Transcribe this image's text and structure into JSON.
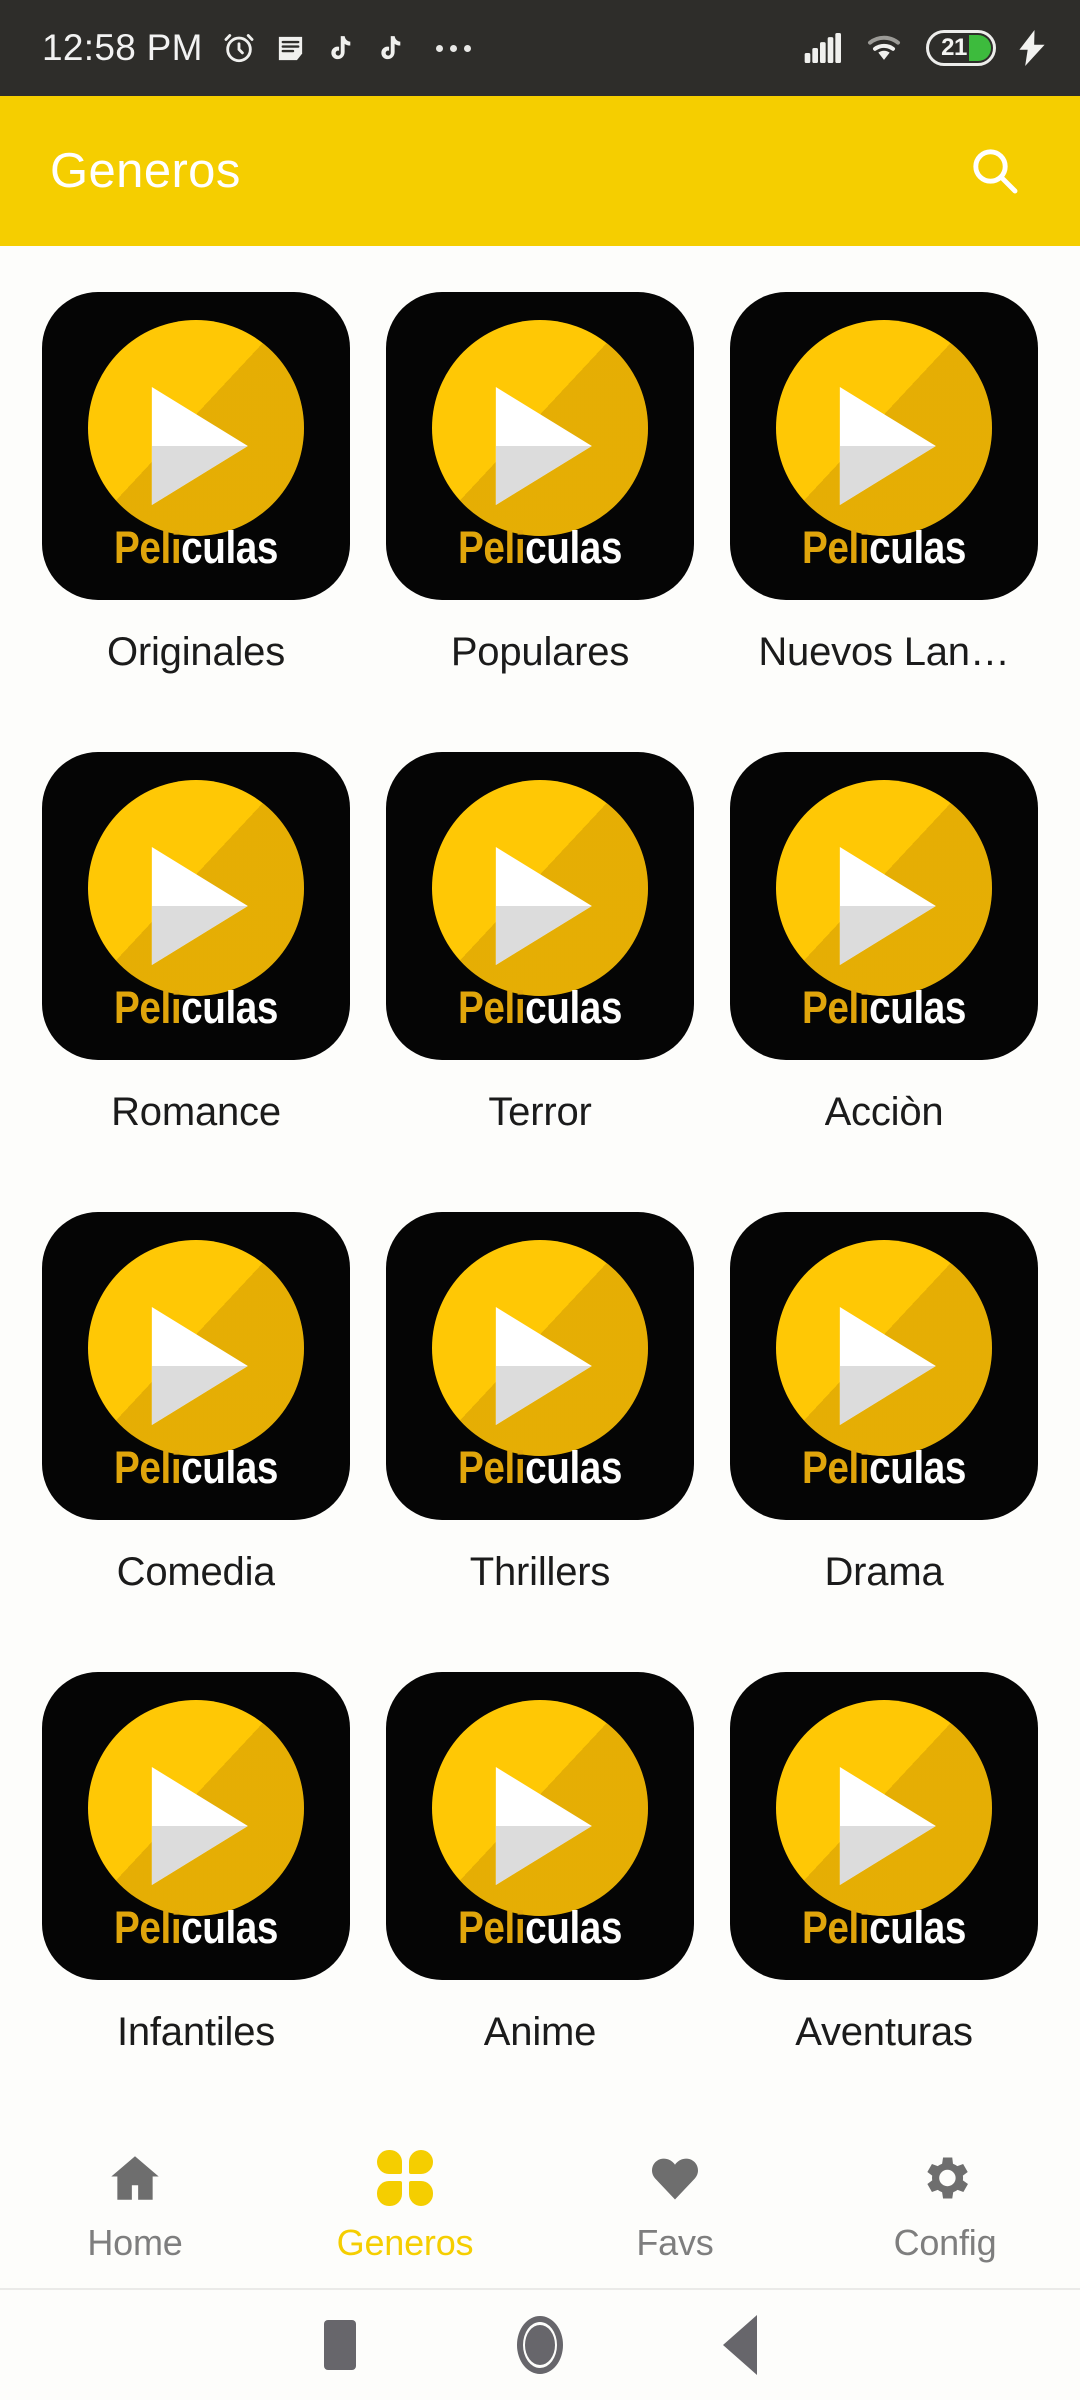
{
  "status_bar": {
    "time": "12:58 PM",
    "left_icons": [
      "alarm-clock-icon",
      "notes-icon",
      "tiktok-icon",
      "tiktok-icon",
      "more-dots-icon"
    ],
    "battery_percent": "21",
    "right_icons": [
      "signal-icon",
      "wifi-icon",
      "battery-icon",
      "charging-bolt-icon"
    ],
    "bg_color": "#2E2D2A"
  },
  "app_bar": {
    "title": "Generos",
    "search_icon": "search-icon",
    "bg_color": "#F5CE00",
    "title_color": "#FFFFFF"
  },
  "tile": {
    "brand_prefix": "Peli",
    "brand_suffix": "culas",
    "brand_prefix_color": "#E0A50B",
    "brand_suffix_color": "#FFFFFF",
    "bg_color": "#050505",
    "circle_color": "#FFC805",
    "play_icon": "play-triangle-icon"
  },
  "grid": {
    "items": [
      {
        "label": "Originales"
      },
      {
        "label": "Populares"
      },
      {
        "label": "Nuevos Lan…"
      },
      {
        "label": "Romance"
      },
      {
        "label": "Terror"
      },
      {
        "label": "Acciòn"
      },
      {
        "label": "Comedia"
      },
      {
        "label": "Thrillers"
      },
      {
        "label": "Drama"
      },
      {
        "label": "Infantiles"
      },
      {
        "label": "Anime"
      },
      {
        "label": "Aventuras"
      }
    ]
  },
  "bottom_nav": {
    "active_color": "#F5CE00",
    "inactive_color": "#7E7E7E",
    "items": [
      {
        "label": "Home",
        "icon": "home-icon",
        "active": false
      },
      {
        "label": "Generos",
        "icon": "grid-icon",
        "active": true
      },
      {
        "label": "Favs",
        "icon": "heart-icon",
        "active": false
      },
      {
        "label": "Config",
        "icon": "gear-icon",
        "active": false
      }
    ]
  },
  "system_nav": {
    "buttons": [
      "recents-square-icon",
      "home-circle-icon",
      "back-triangle-icon"
    ]
  }
}
